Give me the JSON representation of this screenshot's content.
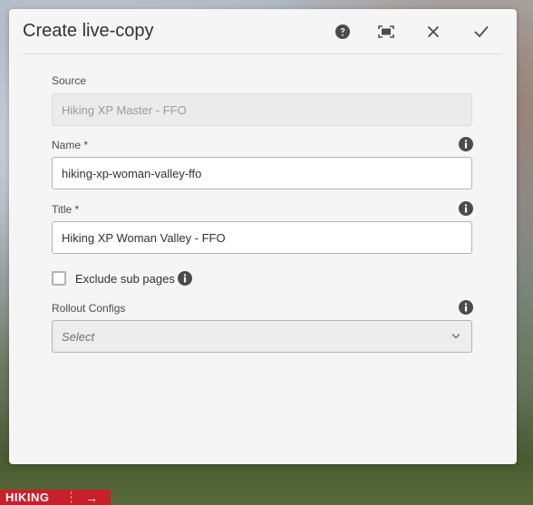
{
  "dialog": {
    "title": "Create live-copy",
    "actions": {
      "help_icon": "help-circle-icon",
      "fullscreen_icon": "fullscreen-icon",
      "close_icon": "close-icon",
      "done_icon": "checkmark-icon"
    }
  },
  "form": {
    "source": {
      "label": "Source",
      "value": "Hiking XP Master - FFO"
    },
    "name": {
      "label": "Name *",
      "value": "hiking-xp-woman-valley-ffo"
    },
    "title": {
      "label": "Title *",
      "value": "Hiking XP Woman Valley - FFO"
    },
    "exclude_sub_pages": {
      "label": "Exclude sub pages",
      "checked": false
    },
    "rollout_configs": {
      "label": "Rollout Configs",
      "placeholder": "Select"
    }
  },
  "bottom_nav": {
    "label": "HIKING",
    "arrow": "→"
  },
  "colors": {
    "accent": "#c8202a",
    "dialog_bg": "#f5f5f5",
    "icon": "#4b4b4b"
  }
}
